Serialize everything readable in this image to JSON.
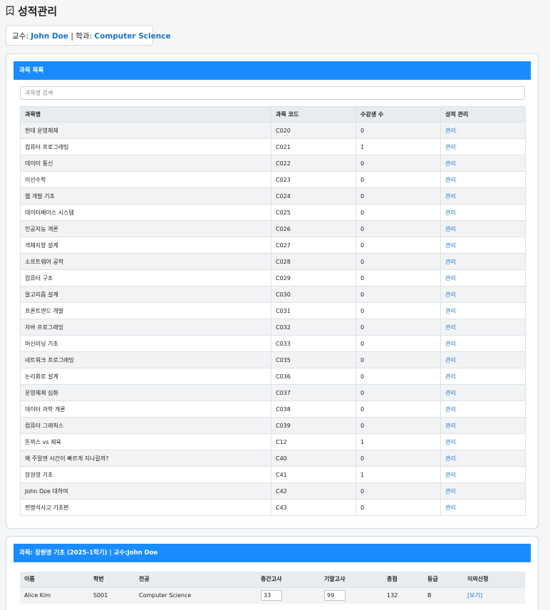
{
  "page": {
    "title": "성적관리",
    "professor_label": "교수:",
    "professor_name": "John Doe",
    "separator": "|",
    "department_label": "학과:",
    "department_name": "Computer Science"
  },
  "course_list": {
    "header": "과목 목록",
    "search_placeholder": "과목명 검색",
    "columns": [
      "과목명",
      "과목 코드",
      "수강생 수",
      "성적 관리"
    ],
    "rows": [
      {
        "name": "현대 운영체제",
        "code": "C020",
        "students": "0",
        "action": "관리"
      },
      {
        "name": "컴퓨터 프로그래밍",
        "code": "C021",
        "students": "1",
        "action": "관리"
      },
      {
        "name": "데이터 통신",
        "code": "C022",
        "students": "0",
        "action": "관리"
      },
      {
        "name": "이산수학",
        "code": "C023",
        "students": "0",
        "action": "관리"
      },
      {
        "name": "웹 개발 기초",
        "code": "C024",
        "students": "0",
        "action": "관리"
      },
      {
        "name": "데이터베이스 시스템",
        "code": "C025",
        "students": "0",
        "action": "관리"
      },
      {
        "name": "인공지능 개론",
        "code": "C026",
        "students": "0",
        "action": "관리"
      },
      {
        "name": "객체지향 설계",
        "code": "C027",
        "students": "0",
        "action": "관리"
      },
      {
        "name": "소프트웨어 공학",
        "code": "C028",
        "students": "0",
        "action": "관리"
      },
      {
        "name": "컴퓨터 구조",
        "code": "C029",
        "students": "0",
        "action": "관리"
      },
      {
        "name": "알고리즘 설계",
        "code": "C030",
        "students": "0",
        "action": "관리"
      },
      {
        "name": "프론트엔드 개발",
        "code": "C031",
        "students": "0",
        "action": "관리"
      },
      {
        "name": "자바 프로그래밍",
        "code": "C032",
        "students": "0",
        "action": "관리"
      },
      {
        "name": "머신러닝 기초",
        "code": "C033",
        "students": "0",
        "action": "관리"
      },
      {
        "name": "네트워크 프로그래밍",
        "code": "C035",
        "students": "0",
        "action": "관리"
      },
      {
        "name": "논리회로 설계",
        "code": "C036",
        "students": "0",
        "action": "관리"
      },
      {
        "name": "운영체제 심화",
        "code": "C037",
        "students": "0",
        "action": "관리"
      },
      {
        "name": "데이터 과학 개론",
        "code": "C038",
        "students": "0",
        "action": "관리"
      },
      {
        "name": "컴퓨터 그래픽스",
        "code": "C039",
        "students": "0",
        "action": "관리"
      },
      {
        "name": "돈까스 vs 제육",
        "code": "C12",
        "students": "1",
        "action": "관리"
      },
      {
        "name": "왜 주말엔 시간이 빠르게 지나갈까?",
        "code": "C40",
        "students": "0",
        "action": "관리"
      },
      {
        "name": "장원영 기초",
        "code": "C41",
        "students": "1",
        "action": "관리"
      },
      {
        "name": "John Doe 대하여",
        "code": "C42",
        "students": "0",
        "action": "관리"
      },
      {
        "name": "찐명석사고 기초편",
        "code": "C43",
        "students": "0",
        "action": "관리"
      }
    ]
  },
  "grade_section": {
    "header": "과목: 장원영 기초 (2025-1학기) | 교수:John Doe",
    "columns": [
      "이름",
      "학번",
      "전공",
      "중간고사",
      "기말고사",
      "총점",
      "등급",
      "이의신청"
    ],
    "rows": [
      {
        "name": "Alice Kim",
        "id": "S001",
        "major": "Computer Science",
        "midterm": "33",
        "final": "99",
        "total": "132",
        "grade": "B",
        "appeal": "[보기]"
      }
    ]
  }
}
